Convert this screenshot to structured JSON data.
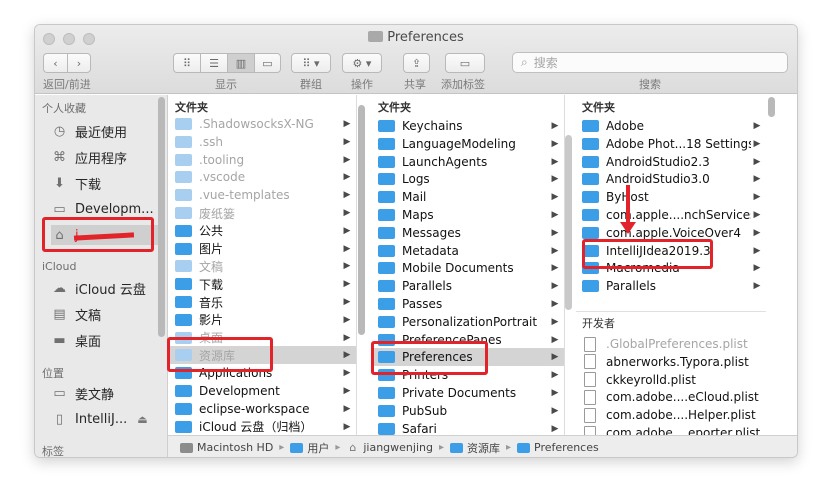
{
  "window": {
    "title": "Preferences"
  },
  "toolbar": {
    "labels": {
      "nav": "返回/前进",
      "view": "显示",
      "group": "群组",
      "action": "操作",
      "share": "共享",
      "tags": "添加标签",
      "search": "搜索"
    },
    "search_placeholder": "搜索",
    "active_view": "columns"
  },
  "sidebar": {
    "sections": [
      {
        "title": "个人收藏",
        "items": [
          {
            "label": "最近使用",
            "icon": "clock-icon"
          },
          {
            "label": "应用程序",
            "icon": "applications-icon"
          },
          {
            "label": "下载",
            "icon": "download-icon"
          },
          {
            "label": "Developm...",
            "icon": "folder-icon"
          },
          {
            "label": "j...",
            "icon": "home-icon",
            "selected": true
          }
        ]
      },
      {
        "title": "iCloud",
        "items": [
          {
            "label": "iCloud 云盘",
            "icon": "cloud-icon"
          },
          {
            "label": "文稿",
            "icon": "document-icon"
          },
          {
            "label": "桌面",
            "icon": "desktop-icon"
          }
        ]
      },
      {
        "title": "位置",
        "items": [
          {
            "label": "姜文静",
            "icon": "laptop-icon"
          },
          {
            "label": "IntelliJ...",
            "icon": "disk-icon"
          }
        ]
      },
      {
        "title": "标签",
        "items": []
      }
    ]
  },
  "columns": [
    {
      "header": "文件夹",
      "rows": [
        {
          "label": ".ShadowsocksX-NG",
          "faded": true
        },
        {
          "label": ".ssh",
          "faded": true
        },
        {
          "label": ".tooling",
          "faded": true
        },
        {
          "label": ".vscode",
          "faded": true
        },
        {
          "label": ".vue-templates",
          "faded": true
        },
        {
          "label": "废纸篓",
          "faded": true
        },
        {
          "label": "公共"
        },
        {
          "label": "图片"
        },
        {
          "label": "文稿",
          "faded": true
        },
        {
          "label": "下载"
        },
        {
          "label": "音乐"
        },
        {
          "label": "影片"
        },
        {
          "label": "桌面",
          "faded": true
        },
        {
          "label": "资源库",
          "faded": true,
          "selected": true
        },
        {
          "label": "Applications"
        },
        {
          "label": "Development"
        },
        {
          "label": "eclipse-workspace"
        },
        {
          "label": "iCloud 云盘（归档）"
        }
      ]
    },
    {
      "header": "文件夹",
      "rows": [
        {
          "label": "Keychains"
        },
        {
          "label": "LanguageModeling"
        },
        {
          "label": "LaunchAgents"
        },
        {
          "label": "Logs"
        },
        {
          "label": "Mail"
        },
        {
          "label": "Maps"
        },
        {
          "label": "Messages"
        },
        {
          "label": "Metadata"
        },
        {
          "label": "Mobile Documents"
        },
        {
          "label": "Parallels"
        },
        {
          "label": "Passes"
        },
        {
          "label": "PersonalizationPortrait"
        },
        {
          "label": "PreferencePanes"
        },
        {
          "label": "Preferences",
          "selected": true
        },
        {
          "label": "Printers"
        },
        {
          "label": "Private Documents"
        },
        {
          "label": "PubSub"
        },
        {
          "label": "Safari"
        }
      ]
    },
    {
      "header": "文件夹",
      "rows": [
        {
          "label": "Adobe"
        },
        {
          "label": "Adobe Phot...18 Settings"
        },
        {
          "label": "AndroidStudio2.3"
        },
        {
          "label": "AndroidStudio3.0"
        },
        {
          "label": "ByHost"
        },
        {
          "label": "com.apple....nchServices"
        },
        {
          "label": "com.apple.VoiceOver4"
        },
        {
          "label": "IntelliJIdea2019.3"
        },
        {
          "label": "Macromedia"
        },
        {
          "label": "Parallels"
        }
      ],
      "files_header": "开发者",
      "files": [
        {
          "label": ".GlobalPreferences.plist",
          "faded": true
        },
        {
          "label": "abnerworks.Typora.plist"
        },
        {
          "label": "ckkeyrolld.plist"
        },
        {
          "label": "com.adobe....eCloud.plist"
        },
        {
          "label": "com.adobe....Helper.plist"
        },
        {
          "label": "com.adobe....eporter.plist"
        }
      ]
    }
  ],
  "pathbar": [
    {
      "label": "Macintosh HD",
      "icon": "hd-icon"
    },
    {
      "label": "用户",
      "icon": "folder-icon"
    },
    {
      "label": "jiangwenjing",
      "icon": "home-icon"
    },
    {
      "label": "资源库",
      "icon": "folder-icon"
    },
    {
      "label": "Preferences",
      "icon": "folder-icon"
    }
  ],
  "colors": {
    "folder": "#3d9ee8",
    "annotation": "#e2232a",
    "selection": "#d4d4d4"
  }
}
